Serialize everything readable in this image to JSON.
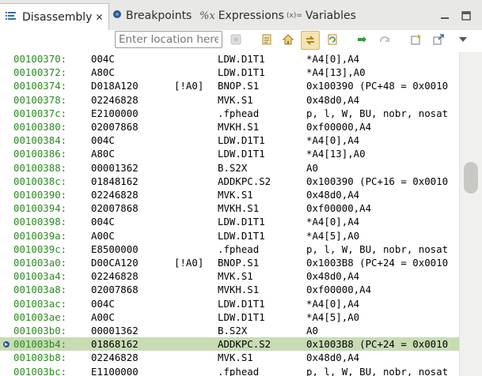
{
  "tabs": [
    {
      "label": "Disassembly",
      "icon": "disassembly-icon",
      "active": true
    },
    {
      "label": "Breakpoints",
      "icon": "breakpoints-icon",
      "active": false
    },
    {
      "label": "Expressions",
      "icon": "expressions-icon",
      "active": false
    },
    {
      "label": "Variables",
      "icon": "variables-icon",
      "active": false
    }
  ],
  "variables_prefix": "(x)=",
  "toolbar": {
    "location_placeholder": "Enter location here"
  },
  "rows": [
    {
      "addr": "00100370:",
      "op": "004C",
      "pred": "",
      "mn": "LDW.D1T1",
      "ops": "*A4[0],A4"
    },
    {
      "addr": "00100372:",
      "op": "A80C",
      "pred": "",
      "mn": "LDW.D1T1",
      "ops": "*A4[13],A0"
    },
    {
      "addr": "00100374:",
      "op": "D018A120",
      "pred": "[!A0]",
      "mn": "BNOP.S1",
      "ops": "0x100390 (PC+48 = 0x0010"
    },
    {
      "addr": "00100378:",
      "op": "02246828",
      "pred": "",
      "mn": "MVK.S1",
      "ops": "0x48d0,A4"
    },
    {
      "addr": "0010037c:",
      "op": "E2100000",
      "pred": "",
      "mn": ".fphead",
      "ops": "p, l, W, BU, nobr, nosat"
    },
    {
      "addr": "00100380:",
      "op": "02007868",
      "pred": "",
      "mn": "MVKH.S1",
      "ops": "0xf00000,A4"
    },
    {
      "addr": "00100384:",
      "op": "004C",
      "pred": "",
      "mn": "LDW.D1T1",
      "ops": "*A4[0],A4"
    },
    {
      "addr": "00100386:",
      "op": "A80C",
      "pred": "",
      "mn": "LDW.D1T1",
      "ops": "*A4[13],A0"
    },
    {
      "addr": "00100388:",
      "op": "00001362",
      "pred": "",
      "mn": "B.S2X",
      "ops": "A0"
    },
    {
      "addr": "0010038c:",
      "op": "01848162",
      "pred": "",
      "mn": "ADDKPC.S2",
      "ops": "0x100390 (PC+16 = 0x0010"
    },
    {
      "addr": "00100390:",
      "op": "02246828",
      "pred": "",
      "mn": "MVK.S1",
      "ops": "0x48d0,A4"
    },
    {
      "addr": "00100394:",
      "op": "02007868",
      "pred": "",
      "mn": "MVKH.S1",
      "ops": "0xf00000,A4"
    },
    {
      "addr": "00100398:",
      "op": "004C",
      "pred": "",
      "mn": "LDW.D1T1",
      "ops": "*A4[0],A4"
    },
    {
      "addr": "0010039a:",
      "op": "A00C",
      "pred": "",
      "mn": "LDW.D1T1",
      "ops": "*A4[5],A0"
    },
    {
      "addr": "0010039c:",
      "op": "E8500000",
      "pred": "",
      "mn": ".fphead",
      "ops": "p, l, W, BU, nobr, nosat"
    },
    {
      "addr": "001003a0:",
      "op": "D00CA120",
      "pred": "[!A0]",
      "mn": "BNOP.S1",
      "ops": "0x1003B8 (PC+24 = 0x0010"
    },
    {
      "addr": "001003a4:",
      "op": "02246828",
      "pred": "",
      "mn": "MVK.S1",
      "ops": "0x48d0,A4"
    },
    {
      "addr": "001003a8:",
      "op": "02007868",
      "pred": "",
      "mn": "MVKH.S1",
      "ops": "0xf00000,A4"
    },
    {
      "addr": "001003ac:",
      "op": "004C",
      "pred": "",
      "mn": "LDW.D1T1",
      "ops": "*A4[0],A4"
    },
    {
      "addr": "001003ae:",
      "op": "A00C",
      "pred": "",
      "mn": "LDW.D1T1",
      "ops": "*A4[5],A0"
    },
    {
      "addr": "001003b0:",
      "op": "00001362",
      "pred": "",
      "mn": "B.S2X",
      "ops": "A0"
    },
    {
      "addr": "001003b4:",
      "op": "01868162",
      "pred": "",
      "mn": "ADDKPC.S2",
      "ops": "0x1003B8 (PC+24 = 0x0010",
      "current": true
    },
    {
      "addr": "001003b8:",
      "op": "02246828",
      "pred": "",
      "mn": "MVK.S1",
      "ops": "0x48d0,A4"
    },
    {
      "addr": "001003bc:",
      "op": "E1100000",
      "pred": "",
      "mn": ".fphead",
      "ops": "p, l, W, BU, nobr, nosat"
    }
  ],
  "colors": {
    "address": "#2a8a20",
    "current_line": "#c8dcb4",
    "tabbar": "#e8e8e6"
  }
}
